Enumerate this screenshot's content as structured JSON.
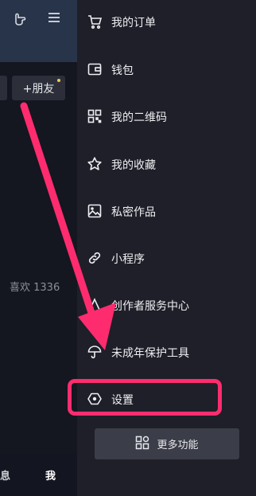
{
  "left": {
    "friend_button": "+朋友",
    "likes_text": "喜欢 1336",
    "nav_messages": "息",
    "nav_me": "我"
  },
  "drawer": {
    "items": [
      {
        "label": "我的订单",
        "icon": "cart-icon"
      },
      {
        "label": "钱包",
        "icon": "wallet-icon"
      },
      {
        "label": "我的二维码",
        "icon": "qrcode-icon"
      },
      {
        "label": "我的收藏",
        "icon": "star-icon"
      },
      {
        "label": "私密作品",
        "icon": "private-image-icon"
      },
      {
        "label": "小程序",
        "icon": "link-icon"
      },
      {
        "label": "创作者服务中心",
        "icon": "creator-icon"
      },
      {
        "label": "未成年保护工具",
        "icon": "umbrella-icon"
      },
      {
        "label": "设置",
        "icon": "settings-icon"
      }
    ],
    "more_button": "更多功能"
  },
  "colors": {
    "highlight": "#fe2c6e",
    "drawer_bg": "#1e1f28",
    "left_bg": "#141620"
  }
}
